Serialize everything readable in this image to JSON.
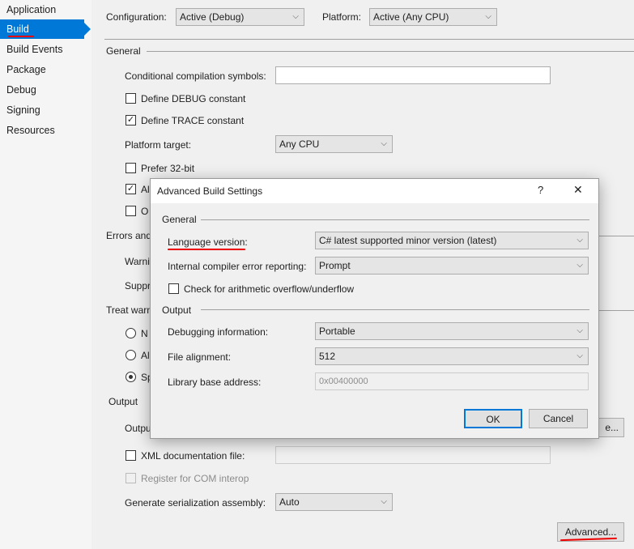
{
  "sidebar": {
    "items": [
      {
        "label": "Application"
      },
      {
        "label": "Build",
        "selected": true
      },
      {
        "label": "Build Events"
      },
      {
        "label": "Package"
      },
      {
        "label": "Debug"
      },
      {
        "label": "Signing"
      },
      {
        "label": "Resources"
      }
    ]
  },
  "header": {
    "configuration_label": "Configuration:",
    "configuration_value": "Active (Debug)",
    "platform_label": "Platform:",
    "platform_value": "Active (Any CPU)"
  },
  "general": {
    "title": "General",
    "symbols_label": "Conditional compilation symbols:",
    "symbols_value": "",
    "define_debug": "Define DEBUG constant",
    "define_debug_checked": false,
    "define_trace": "Define TRACE constant",
    "define_trace_checked": true,
    "platform_target_label": "Platform target:",
    "platform_target_value": "Any CPU",
    "prefer32": "Prefer 32-bit",
    "prefer32_checked": false,
    "allow_partial": "Al",
    "allow_checked": true,
    "optimize_partial": "O",
    "optimize_checked": false
  },
  "errors": {
    "title_partial": "Errors and",
    "warning_partial": "Warni",
    "suppress_partial": "Suppr",
    "treat_partial": "Treat warn",
    "radio_none_partial": "N",
    "radio_all_partial": "Al",
    "radio_specific_partial": "Sp"
  },
  "output": {
    "title": "Output",
    "path_partial": "Outpu",
    "browse_partial": "e...",
    "xml_doc_label": "XML documentation file:",
    "xml_doc_value": "",
    "com_interop": "Register for COM interop",
    "serialization_label": "Generate serialization assembly:",
    "serialization_value": "Auto",
    "advanced_button": "Advanced..."
  },
  "dialog": {
    "title": "Advanced Build Settings",
    "help": "?",
    "close": "✕",
    "general_title": "General",
    "language_label": "Language version:",
    "language_value": "C# latest supported minor version (latest)",
    "ice_label": "Internal compiler error reporting:",
    "ice_value": "Prompt",
    "overflow_label": "Check for arithmetic overflow/underflow",
    "overflow_checked": false,
    "output_title": "Output",
    "debug_info_label": "Debugging information:",
    "debug_info_value": "Portable",
    "file_alignment_label": "File alignment:",
    "file_alignment_value": "512",
    "base_address_label": "Library base address:",
    "base_address_value": "0x00400000",
    "ok": "OK",
    "cancel": "Cancel"
  },
  "colors": {
    "accent": "#0078d7",
    "annotation": "#e00000"
  }
}
